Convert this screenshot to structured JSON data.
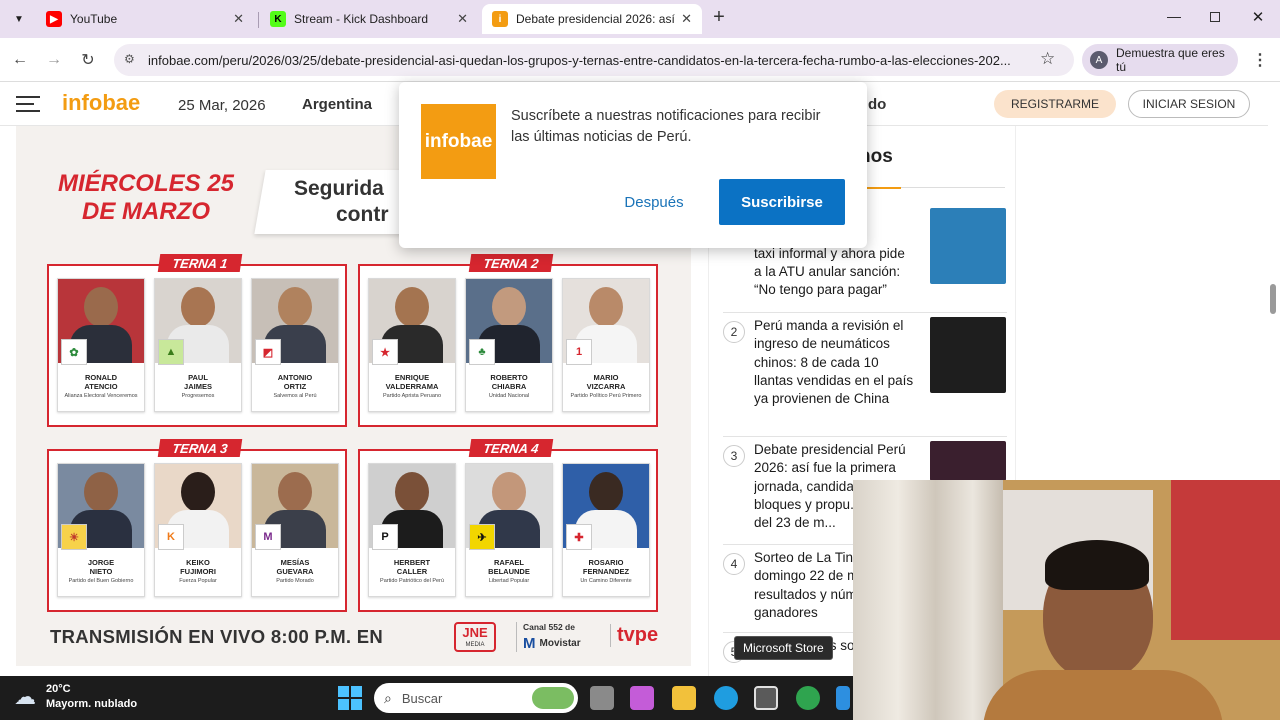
{
  "browser": {
    "tabs": [
      {
        "title": "YouTube",
        "icon": "youtube-icon",
        "color": "#ff0000",
        "active": false
      },
      {
        "title": "Stream - Kick Dashboard",
        "icon": "kick-icon",
        "color": "#53fc18",
        "active": false
      },
      {
        "title": "Debate presidencial 2026: así q",
        "icon": "infobae-icon",
        "color": "#f39c12",
        "active": true
      }
    ],
    "new_tab": "+",
    "url": "infobae.com/peru/2026/03/25/debate-presidencial-asi-quedan-los-grupos-y-ternas-entre-candidatos-en-la-tercera-fecha-rumbo-a-las-elecciones-202...",
    "profile_label": "Demuestra que eres tú"
  },
  "site": {
    "logo": "infobae",
    "date": "25 Mar, 2026",
    "nav_country": "Argentina",
    "nav_partial": "do",
    "register": "REGISTRARME",
    "login": "INICIAR SESION"
  },
  "infographic": {
    "date_line1": "MIÉRCOLES 25",
    "date_line2": "DE MARZO",
    "banner_line1": "Segurida",
    "banner_line2": "contr",
    "ternas": [
      {
        "title": "TERNA 1",
        "candidates": [
          {
            "name": "RONALD\nATENCIO",
            "party": "Alianza Electoral Venceremos",
            "logo_color": "#2e8b3d"
          },
          {
            "name": "PAUL\nJAIMES",
            "party": "Progresemos",
            "logo_color": "#7cc242"
          },
          {
            "name": "ANTONIO\nORTIZ",
            "party": "Salvemos al Perú",
            "logo_color": "#d6262f"
          }
        ]
      },
      {
        "title": "TERNA 2",
        "candidates": [
          {
            "name": "ENRIQUE\nVALDERRAMA",
            "party": "Partido Aprista Peruano",
            "logo_color": "#d6262f"
          },
          {
            "name": "ROBERTO\nCHIABRA",
            "party": "Unidad Nacional",
            "logo_color": "#2e8b3d"
          },
          {
            "name": "MARIO\nVIZCARRA",
            "party": "Partido Político Perú Primero",
            "logo_color": "#d6262f"
          }
        ]
      },
      {
        "title": "TERNA 3",
        "candidates": [
          {
            "name": "JORGE\nNIETO",
            "party": "Partido del Buen Gobierno",
            "logo_color": "#e8a317"
          },
          {
            "name": "KEIKO\nFUJIMORI",
            "party": "Fuerza Popular",
            "logo_color": "#f07b1a"
          },
          {
            "name": "MESÍAS\nGUEVARA",
            "party": "Partido Morado",
            "logo_color": "#7a2a8c"
          }
        ]
      },
      {
        "title": "TERNA 4",
        "candidates": [
          {
            "name": "HERBERT\nCALLER",
            "party": "Partido Patriótico del Perú",
            "logo_color": "#111111"
          },
          {
            "name": "RAFAEL\nBELAUNDE",
            "party": "Libertad Popular",
            "logo_color": "#f2d600"
          },
          {
            "name": "ROSARIO\nFERNANDEZ",
            "party": "Un Camino Diferente",
            "logo_color": "#d6262f"
          }
        ]
      }
    ],
    "broadcast": "TRANSMISIÓN EN VIVO 8:00 P.M. EN",
    "jne": "JNE",
    "jne_sub": "MEDIA",
    "canal": "Canal 552 de",
    "movistar": "Movistar",
    "tvpe": "tvpe"
  },
  "sidebar": {
    "heading_partial": "nos",
    "items": [
      {
        "num": "",
        "text": "...500 a\n...alizar\ntaxi informal y ahora pide\na la ATU anular sanción:\n“No tengo para pagar”"
      },
      {
        "num": "2",
        "text": "Perú manda a revisión el ingreso de neumáticos chinos: 8 de cada 10 llantas vendidas en el país ya provienen de China"
      },
      {
        "num": "3",
        "text": "Debate presidencial Perú 2026: así fue la primera jornada, candidat... bloques y propu... clave del 23 de m..."
      },
      {
        "num": "4",
        "text": "Sorteo de La Tin... domingo 22 de m... resultados y núm... ganadores"
      },
      {
        "num": "5",
        "text": "...den... Estos son los ca..."
      }
    ]
  },
  "popup": {
    "logo": "infobae",
    "message": "Suscríbete a nuestras notificaciones para recibir las últimas noticias de Perú.",
    "later": "Después",
    "subscribe": "Suscribirse"
  },
  "taskbar": {
    "temp": "20°C",
    "weather": "Mayorm. nublado",
    "search_placeholder": "Buscar",
    "tooltip": "Microsoft Store"
  }
}
